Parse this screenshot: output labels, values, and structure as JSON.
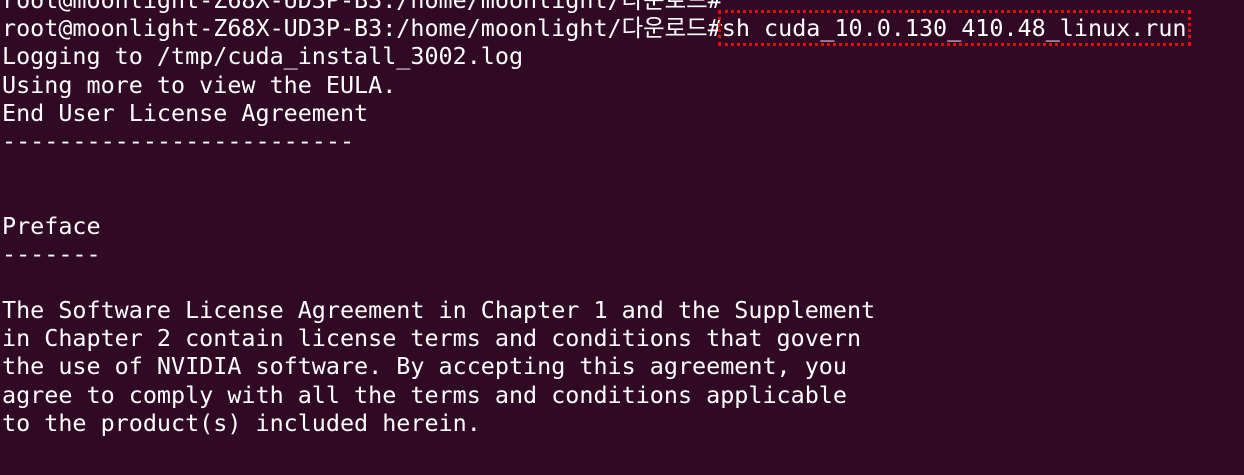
{
  "terminal": {
    "lines": [
      "root@moonlight-Z68X-UD3P-B3:/home/moonlight/다운로드#",
      "",
      "Logging to /tmp/cuda_install_3002.log",
      "Using more to view the EULA.",
      "End User License Agreement",
      "-------------------------",
      "",
      "",
      "Preface",
      "-------",
      "",
      "The Software License Agreement in Chapter 1 and the Supplement",
      "in Chapter 2 contain license terms and conditions that govern",
      "the use of NVIDIA software. By accepting this agreement, you",
      "agree to comply with all the terms and conditions applicable",
      "to the product(s) included herein."
    ],
    "prompt": "root@moonlight-Z68X-UD3P-B3:/home/moonlight/다운로드#",
    "command": "sh cuda_10.0.130_410.48_linux.run"
  },
  "colors": {
    "background": "#300a24",
    "text": "#ffffff",
    "highlight_border": "#e8070c"
  }
}
